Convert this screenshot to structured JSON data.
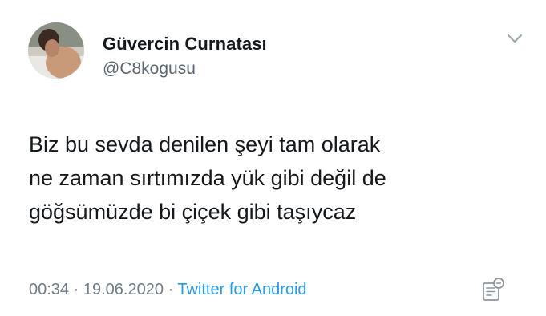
{
  "tweet": {
    "display_name": "Güvercin Curnatası",
    "username": "@C8kogusu",
    "text_lines": [
      "Biz bu sevda denilen şeyi tam olarak",
      "ne zaman sırtımızda yük gibi değil de",
      "göğsümüzde bi çiçek gibi taşıycaz"
    ],
    "time": "00:34",
    "separator": "·",
    "date": "19.06.2020",
    "source": "Twitter for Android"
  },
  "icons": {
    "menu": "chevron-down-icon",
    "analytics": "tweet-analytics-icon"
  },
  "colors": {
    "name": "#15181c",
    "secondary": "#707c86",
    "link": "#2a9ae3",
    "background": "#ffffff"
  }
}
